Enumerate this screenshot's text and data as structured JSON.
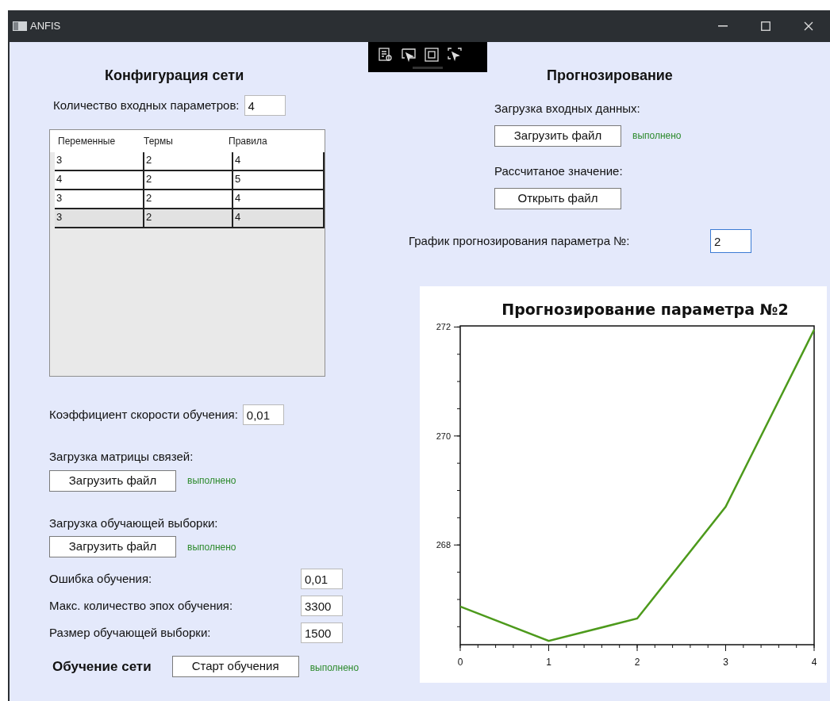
{
  "window": {
    "title": "ANFIS"
  },
  "config": {
    "heading": "Конфигурация сети",
    "inputs_count": {
      "label": "Количество входных параметров:",
      "value": "4"
    },
    "table": {
      "columns": [
        "Переменные",
        "Термы",
        "Правила"
      ],
      "rows": [
        {
          "cells": [
            "3",
            "2",
            "4"
          ],
          "selected": false
        },
        {
          "cells": [
            "4",
            "2",
            "5"
          ],
          "selected": false
        },
        {
          "cells": [
            "3",
            "2",
            "4"
          ],
          "selected": false
        },
        {
          "cells": [
            "3",
            "2",
            "4"
          ],
          "selected": true
        }
      ]
    },
    "learning_rate": {
      "label": "Коэффициент скорости обучения:",
      "value": "0,01"
    },
    "loads": [
      {
        "label": "Загрузка матрицы связей:",
        "button": "Загрузить файл",
        "status": "выполнено"
      },
      {
        "label": "Загрузка обучающей выборки:",
        "button": "Загрузить файл",
        "status": "выполнено"
      }
    ],
    "params": [
      {
        "label": "Ошибка обучения:",
        "value": "0,01"
      },
      {
        "label": "Макс. количество эпох обучения:",
        "value": "3300"
      },
      {
        "label": "Размер обучающей выборки:",
        "value": "1500"
      }
    ],
    "training": {
      "heading": "Обучение сети",
      "button": "Старт обучения",
      "status": "выполнено"
    }
  },
  "forecast": {
    "heading": "Прогнозирование",
    "input_data": {
      "label": "Загрузка входных данных:",
      "button": "Загрузить файл",
      "status": "выполнено"
    },
    "computed": {
      "label": "Рассчитаное значение:",
      "button": "Открыть файл"
    },
    "param_select": {
      "label": "График прогнозирования параметра №:",
      "value": "2"
    },
    "chart_data": {
      "type": "line",
      "title": "Прогнозирование параметра №2",
      "x": [
        0,
        1,
        2,
        3,
        4
      ],
      "series": [
        {
          "color": "#4d9a1c",
          "values": [
            266.87,
            266.24,
            266.65,
            268.7,
            271.95
          ]
        }
      ],
      "xlim": [
        0,
        4
      ],
      "ylim": [
        266.17,
        272.02
      ],
      "xticks": [
        0,
        1,
        2,
        3,
        4
      ],
      "yticks": [
        268,
        270,
        272
      ]
    }
  }
}
